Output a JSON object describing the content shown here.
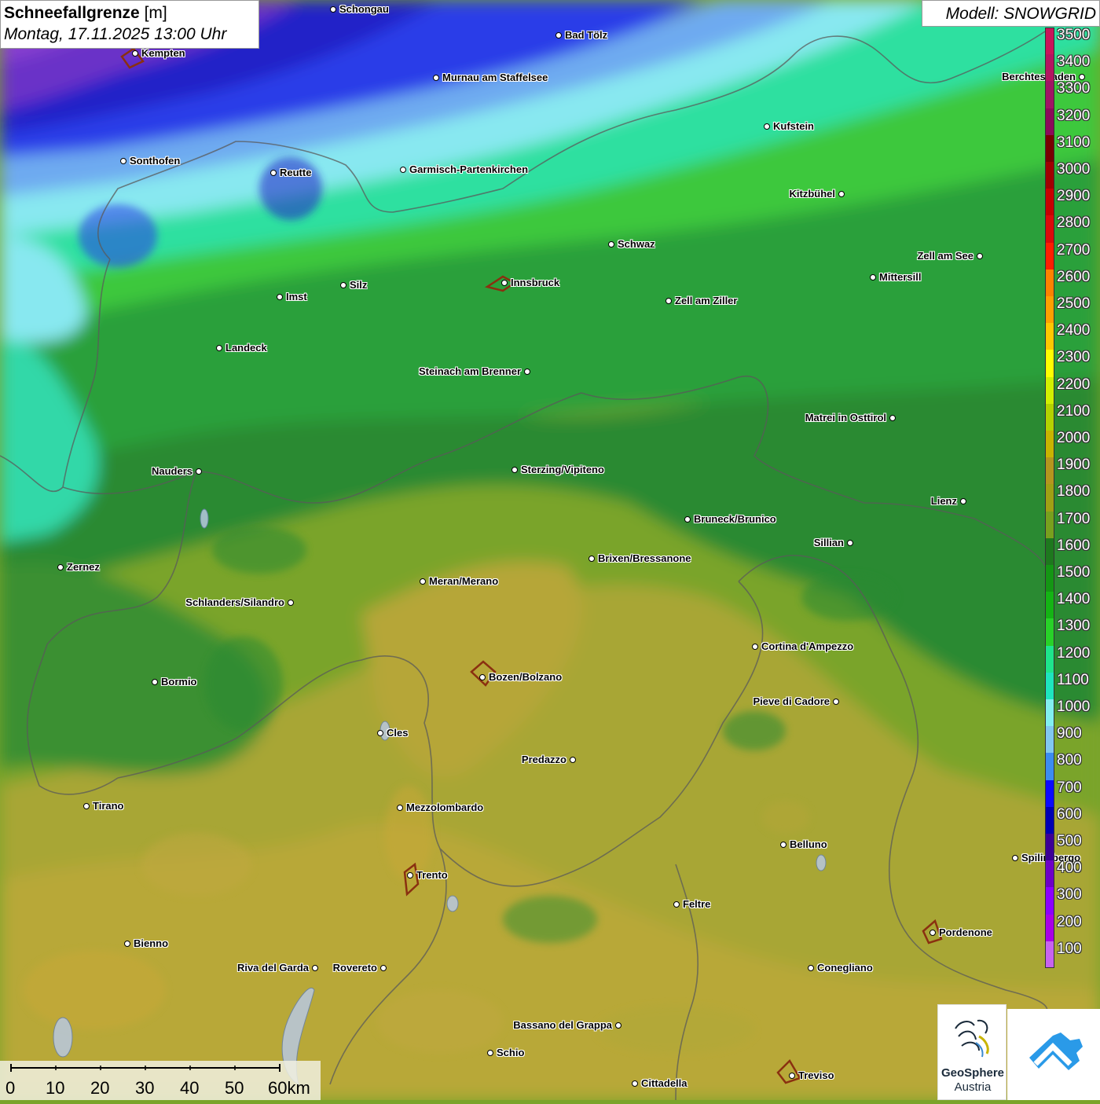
{
  "header": {
    "title_bold": "Schneefallgrenze",
    "title_unit": "[m]",
    "datetime": "Montag, 17.11.2025 13:00 Uhr",
    "model": "Modell: SNOWGRID"
  },
  "legend": {
    "entries": [
      {
        "label": "3500",
        "color": "#c8145a"
      },
      {
        "label": "3400",
        "color": "#b41460"
      },
      {
        "label": "3300",
        "color": "#a01464"
      },
      {
        "label": "3200",
        "color": "#8c0a5a"
      },
      {
        "label": "3100",
        "color": "#780000"
      },
      {
        "label": "3000",
        "color": "#a00000"
      },
      {
        "label": "2900",
        "color": "#c80000"
      },
      {
        "label": "2800",
        "color": "#dc0a0a"
      },
      {
        "label": "2700",
        "color": "#ff1e00"
      },
      {
        "label": "2600",
        "color": "#ff8200"
      },
      {
        "label": "2500",
        "color": "#ffa000"
      },
      {
        "label": "2400",
        "color": "#ffc800"
      },
      {
        "label": "2300",
        "color": "#ffff00"
      },
      {
        "label": "2200",
        "color": "#d2f000"
      },
      {
        "label": "2100",
        "color": "#b4d200"
      },
      {
        "label": "2000",
        "color": "#c8b400"
      },
      {
        "label": "1900",
        "color": "#b4961e"
      },
      {
        "label": "1800",
        "color": "#a0a014"
      },
      {
        "label": "1700",
        "color": "#78a01e"
      },
      {
        "label": "1600",
        "color": "#1e781e"
      },
      {
        "label": "1500",
        "color": "#149614"
      },
      {
        "label": "1400",
        "color": "#14b414"
      },
      {
        "label": "1300",
        "color": "#28d228"
      },
      {
        "label": "1200",
        "color": "#1ee68c"
      },
      {
        "label": "1100",
        "color": "#1ee6be"
      },
      {
        "label": "1000",
        "color": "#82f0f0"
      },
      {
        "label": "900",
        "color": "#82c8f0"
      },
      {
        "label": "800",
        "color": "#3c8cf0"
      },
      {
        "label": "700",
        "color": "#0a0aff"
      },
      {
        "label": "600",
        "color": "#0000b4"
      },
      {
        "label": "500",
        "color": "#3c0096"
      },
      {
        "label": "400",
        "color": "#6e00c8"
      },
      {
        "label": "300",
        "color": "#8c00ff"
      },
      {
        "label": "200",
        "color": "#aa00e6"
      },
      {
        "label": "100",
        "color": "#c864f0"
      }
    ]
  },
  "cities": [
    {
      "name": "Schongau",
      "side": "right"
    },
    {
      "name": "Bad Tölz",
      "side": "right"
    },
    {
      "name": "Kempten",
      "side": "right"
    },
    {
      "name": "Murnau am Staffelsee",
      "side": "right"
    },
    {
      "name": "Berchtesgaden",
      "side": "left"
    },
    {
      "name": "Kufstein",
      "side": "right"
    },
    {
      "name": "Sonthofen",
      "side": "right"
    },
    {
      "name": "Reutte",
      "side": "right"
    },
    {
      "name": "Garmisch-Partenkirchen",
      "side": "right"
    },
    {
      "name": "Kitzbühel",
      "side": "left"
    },
    {
      "name": "Schwaz",
      "side": "right"
    },
    {
      "name": "Zell am See",
      "side": "left"
    },
    {
      "name": "Innsbruck",
      "side": "right"
    },
    {
      "name": "Mittersill",
      "side": "right"
    },
    {
      "name": "Silz",
      "side": "right"
    },
    {
      "name": "Imst",
      "side": "right"
    },
    {
      "name": "Zell am Ziller",
      "side": "right"
    },
    {
      "name": "Landeck",
      "side": "right"
    },
    {
      "name": "Steinach am Brenner",
      "side": "left"
    },
    {
      "name": "Matrei in Osttirol",
      "side": "left"
    },
    {
      "name": "Nauders",
      "side": "left"
    },
    {
      "name": "Sterzing/Vipiteno",
      "side": "right"
    },
    {
      "name": "Lienz",
      "side": "left"
    },
    {
      "name": "Bruneck/Brunico",
      "side": "right"
    },
    {
      "name": "Sillian",
      "side": "left"
    },
    {
      "name": "Brixen/Bressanone",
      "side": "right"
    },
    {
      "name": "Zernez",
      "side": "right"
    },
    {
      "name": "Meran/Merano",
      "side": "right"
    },
    {
      "name": "Schlanders/Silandro",
      "side": "left"
    },
    {
      "name": "Cortina d'Ampezzo",
      "side": "right"
    },
    {
      "name": "Bozen/Bolzano",
      "side": "right"
    },
    {
      "name": "Bormio",
      "side": "right"
    },
    {
      "name": "Pieve di Cadore",
      "side": "left"
    },
    {
      "name": "Cles",
      "side": "right"
    },
    {
      "name": "Predazzo",
      "side": "left"
    },
    {
      "name": "Tirano",
      "side": "right"
    },
    {
      "name": "Mezzolombardo",
      "side": "right"
    },
    {
      "name": "Belluno",
      "side": "right"
    },
    {
      "name": "Spilimbergo",
      "side": "right"
    },
    {
      "name": "Trento",
      "side": "right"
    },
    {
      "name": "Feltre",
      "side": "right"
    },
    {
      "name": "Pordenone",
      "side": "right"
    },
    {
      "name": "Bienno",
      "side": "right"
    },
    {
      "name": "Riva del Garda",
      "side": "left"
    },
    {
      "name": "Rovereto",
      "side": "left"
    },
    {
      "name": "Conegliano",
      "side": "right"
    },
    {
      "name": "Bassano del Grappa",
      "side": "left"
    },
    {
      "name": "Schio",
      "side": "right"
    },
    {
      "name": "Treviso",
      "side": "right"
    },
    {
      "name": "Cittadella",
      "side": "right"
    }
  ],
  "scalebar": {
    "labels": [
      "0",
      "10",
      "20",
      "30",
      "40",
      "50",
      "60km"
    ]
  },
  "logos": {
    "geosphere_line1": "GeoSphere",
    "geosphere_line2": "Austria"
  }
}
